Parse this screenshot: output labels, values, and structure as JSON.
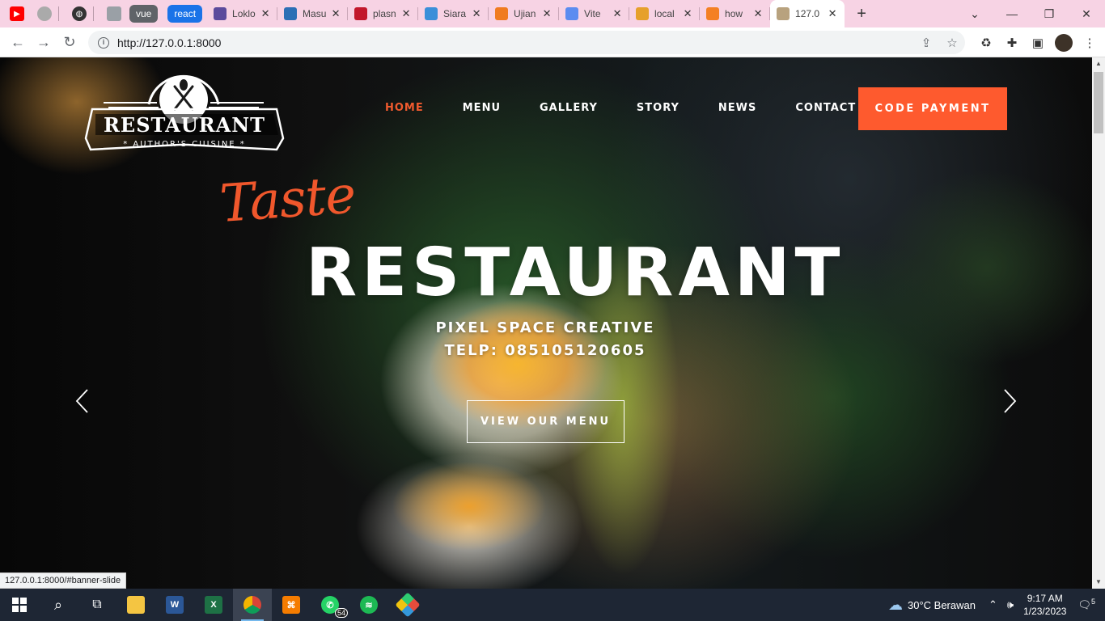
{
  "browser": {
    "group_labels": [
      "vue",
      "react"
    ],
    "tabs": [
      {
        "title": "Loklo",
        "color": "#5b4a9c"
      },
      {
        "title": "Masu",
        "color": "#2c6fb5"
      },
      {
        "title": "plasn",
        "color": "#c2172b"
      },
      {
        "title": "Siara",
        "color": "#3a8fd9"
      },
      {
        "title": "Ujian",
        "color": "#f07b20"
      },
      {
        "title": "Vite",
        "color": "#5b8cf0"
      },
      {
        "title": "local",
        "color": "#e6a02b"
      },
      {
        "title": "how",
        "color": "#f48024"
      },
      {
        "title": "127.0",
        "color": "#b8a27e"
      }
    ],
    "url": "http://127.0.0.1:8000",
    "status_url": "127.0.0.1:8000/#banner-slide"
  },
  "site": {
    "logo": {
      "name": "RESTAURANT",
      "tagline": "AUTHOR'S CUISINE"
    },
    "nav": [
      {
        "label": "HOME",
        "active": true
      },
      {
        "label": "MENU",
        "active": false
      },
      {
        "label": "GALLERY",
        "active": false
      },
      {
        "label": "STORY",
        "active": false
      },
      {
        "label": "NEWS",
        "active": false
      },
      {
        "label": "CONTACT",
        "active": false
      }
    ],
    "cta": "CODE PAYMENT",
    "hero": {
      "script": "Taste",
      "title": "RESTAURANT",
      "subtitle": "PIXEL SPACE CREATIVE",
      "phone": "TELP: 08510512060 5",
      "button": "VIEW OUR MENU"
    },
    "colors": {
      "accent": "#fe5a2e"
    }
  },
  "taskbar": {
    "weather": "30°C  Berawan",
    "time": "9:17 AM",
    "date": "1/23/2023",
    "whatsapp_badge": "54",
    "notifications": "5"
  }
}
